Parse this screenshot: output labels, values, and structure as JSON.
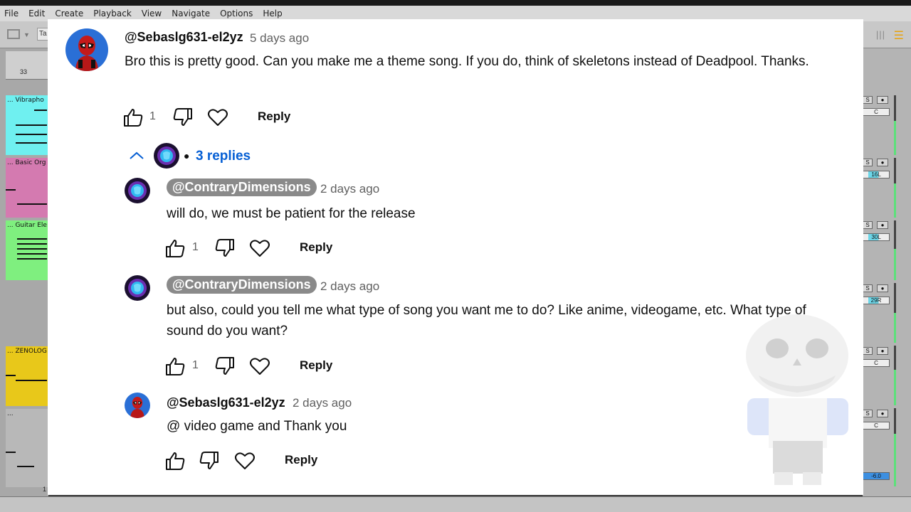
{
  "daw": {
    "menu": [
      "File",
      "Edit",
      "Create",
      "Playback",
      "View",
      "Navigate",
      "Options",
      "Help"
    ],
    "toolbar_tab": "Ta",
    "ruler_number": "33",
    "tracks": [
      {
        "name": "... Vibrapho",
        "color": "#6ff0f0"
      },
      {
        "name": "... Basic Org",
        "color": "#d47ab0"
      },
      {
        "name": "... Guitar Ele",
        "color": "#7fef7f"
      },
      {
        "name": "... ZENOLOG",
        "color": "#e8c81a"
      },
      {
        "name": "...",
        "color": "#a8a8a8"
      }
    ],
    "mixer": [
      {
        "s": "S",
        "pan": "C"
      },
      {
        "s": "S",
        "pan": "16L"
      },
      {
        "s": "S",
        "pan": "30L"
      },
      {
        "s": "S",
        "pan": "29R"
      },
      {
        "s": "S",
        "pan": "C"
      },
      {
        "s": "S",
        "pan": "C"
      }
    ],
    "master_value": "-6.0",
    "bottom_tick": "1"
  },
  "comment": {
    "author": "@Sebaslg631-el2yz",
    "time": "5 days ago",
    "text": "Bro this is pretty good. Can you make me a theme song. If you do, think of skeletons instead of Deadpool. Thanks.",
    "likes": "1",
    "reply_label": "Reply",
    "replies_label": "3 replies"
  },
  "replies": [
    {
      "author": "@ContraryDimensions",
      "time": "2 days ago",
      "text": "will do, we must be patient for the release",
      "likes": "1",
      "reply_label": "Reply"
    },
    {
      "author": "@ContraryDimensions",
      "time": "2 days ago",
      "text": "but also, could you tell me what type of song you want me to do? Like anime, videogame, etc. What type of sound do you want?",
      "likes": "1",
      "reply_label": "Reply"
    },
    {
      "author": "@Sebaslg631-el2yz",
      "time": "2 days ago",
      "text": "@ video game and Thank you",
      "likes": "",
      "reply_label": "Reply"
    }
  ],
  "icons": {
    "like": "thumbs-up-icon",
    "dislike": "thumbs-down-icon",
    "heart": "heart-icon",
    "chevron": "chevron-up-icon"
  },
  "colors": {
    "link_blue": "#065fd4",
    "pill_gray": "#8a8a8a",
    "meter_green": "#5ce07a"
  }
}
